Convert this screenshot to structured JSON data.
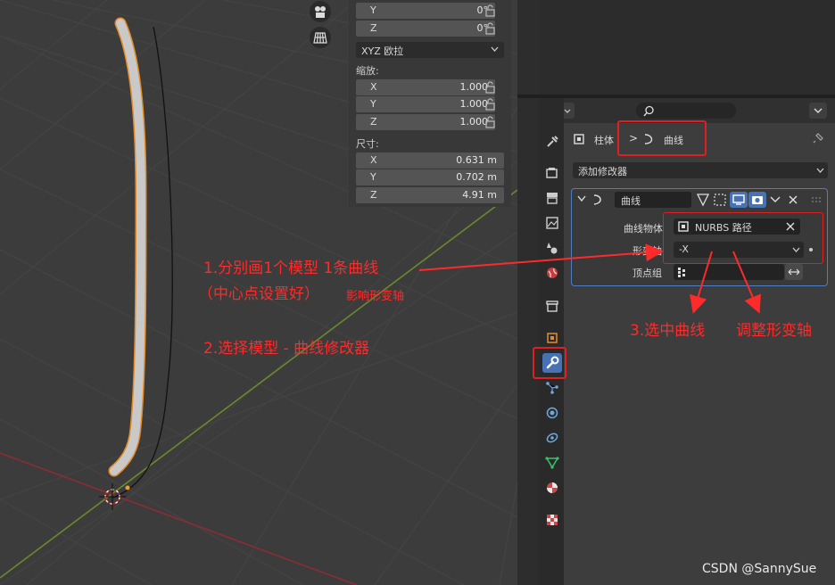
{
  "viewport": {
    "transform": {
      "rotation_rows": [
        {
          "axis": "Y",
          "value": "0°"
        },
        {
          "axis": "Z",
          "value": "0°"
        }
      ],
      "rotation_mode": "XYZ 欧拉",
      "scale_label": "缩放:",
      "scale_rows": [
        {
          "axis": "X",
          "value": "1.000"
        },
        {
          "axis": "Y",
          "value": "1.000"
        },
        {
          "axis": "Z",
          "value": "1.000"
        }
      ],
      "dimensions_label": "尺寸:",
      "dimensions_rows": [
        {
          "axis": "X",
          "value": "0.631 m"
        },
        {
          "axis": "Y",
          "value": "0.702 m"
        },
        {
          "axis": "Z",
          "value": "4.91 m"
        }
      ]
    }
  },
  "properties": {
    "breadcrumb_object": "柱体",
    "breadcrumb_separator": ">",
    "breadcrumb_modifier": "曲线",
    "add_modifier_label": "添加修改器",
    "modifier": {
      "name": "曲线",
      "curve_object_label": "曲线物体",
      "curve_object_value": "NURBS 路径",
      "deform_axis_label": "形变轴",
      "deform_axis_value": "-X",
      "vertex_group_label": "顶点组"
    }
  },
  "annotations": {
    "step1_line1": "1.分别画1个模型 1条曲线",
    "step1_line2": "（中心点设置好）",
    "step1_note": "影响形变轴",
    "step2": "2.选择模型 - 曲线修改器",
    "step3": "3.选中曲线",
    "step4": "调整形变轴",
    "color": "#ff2a2a"
  },
  "watermark": "CSDN @SannySue"
}
